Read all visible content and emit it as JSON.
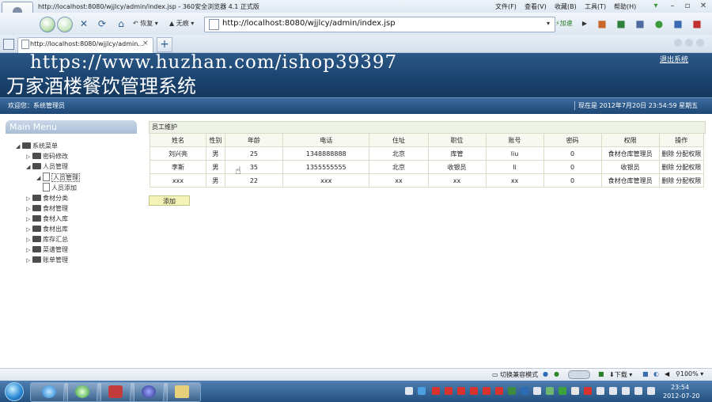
{
  "window": {
    "title": "http://localhost:8080/wjjlcy/admin/index.jsp - 360安全浏览器 4.1 正式版",
    "menus": [
      "文件(F)",
      "查看(V)",
      "收藏(B)",
      "工具(T)",
      "帮助(H)"
    ],
    "controls": [
      "▾",
      "–",
      "▫",
      "✕"
    ]
  },
  "toolbar": {
    "restore_label": "恢复",
    "trace_label": "无痕",
    "address": "http://localhost:8080/wjjlcy/admin/index.jsp",
    "accelerate_label": "加速"
  },
  "tabs": {
    "items": [
      {
        "label": "http://localhost:8080/wjjlcy/admin..."
      }
    ],
    "close": "×",
    "new_tab": "+"
  },
  "page": {
    "watermark_url": "https://www.huzhan.com/ishop39397",
    "system_title": "万家酒楼餐饮管理系统",
    "logout": "退出系统",
    "welcome": "欢迎您：系统管理员",
    "clock": "现在是 2012年7月20日 23:54:59 星期五"
  },
  "menu": {
    "header": "Main Menu",
    "tree": [
      {
        "label": "系统菜单",
        "level": 0,
        "expanded": true
      },
      {
        "label": "密码修改",
        "level": 1,
        "expanded": false
      },
      {
        "label": "人员管理",
        "level": 1,
        "expanded": true
      },
      {
        "label": "人员管理",
        "level": 2,
        "page": true,
        "selected": true
      },
      {
        "label": "人员添加",
        "level": 2,
        "page": true
      },
      {
        "label": "食材分类",
        "level": 1,
        "expanded": false
      },
      {
        "label": "食材管理",
        "level": 1,
        "expanded": false
      },
      {
        "label": "食材入库",
        "level": 1,
        "expanded": false
      },
      {
        "label": "食材出库",
        "level": 1,
        "expanded": false
      },
      {
        "label": "库存汇总",
        "level": 1,
        "expanded": false
      },
      {
        "label": "菜谱管理",
        "level": 1,
        "expanded": false
      },
      {
        "label": "账单管理",
        "level": 1,
        "expanded": false
      }
    ]
  },
  "staff_panel": {
    "title": "员工维护",
    "columns": [
      "姓名",
      "性别",
      "年龄",
      "电话",
      "住址",
      "职位",
      "账号",
      "密码",
      "权限",
      "操作"
    ],
    "rows": [
      [
        "刘兴亮",
        "男",
        "25",
        "1348888888",
        "北京",
        "库管",
        "liu",
        "0",
        "食材仓库管理员"
      ],
      [
        "李斯",
        "男",
        "35",
        "1355555555",
        "北京",
        "收银员",
        "li",
        "0",
        "收银员"
      ],
      [
        "xxx",
        "男",
        "22",
        "xxx",
        "xx",
        "xx",
        "xx",
        "0",
        "食材仓库管理员"
      ]
    ],
    "action_delete": "删除",
    "action_assign": "分配权限",
    "add_button": "添加"
  },
  "statusbar": {
    "compat_mode": "切换兼容模式",
    "download": "下载",
    "zoom": "100%"
  },
  "taskbar": {
    "time": "23:54",
    "date": "2012-07-20"
  },
  "colors": {
    "banner": "#1b4470",
    "infobar": "#2a5889",
    "table_border": "#d9ddc8",
    "add_button": "#f3f3b7"
  }
}
